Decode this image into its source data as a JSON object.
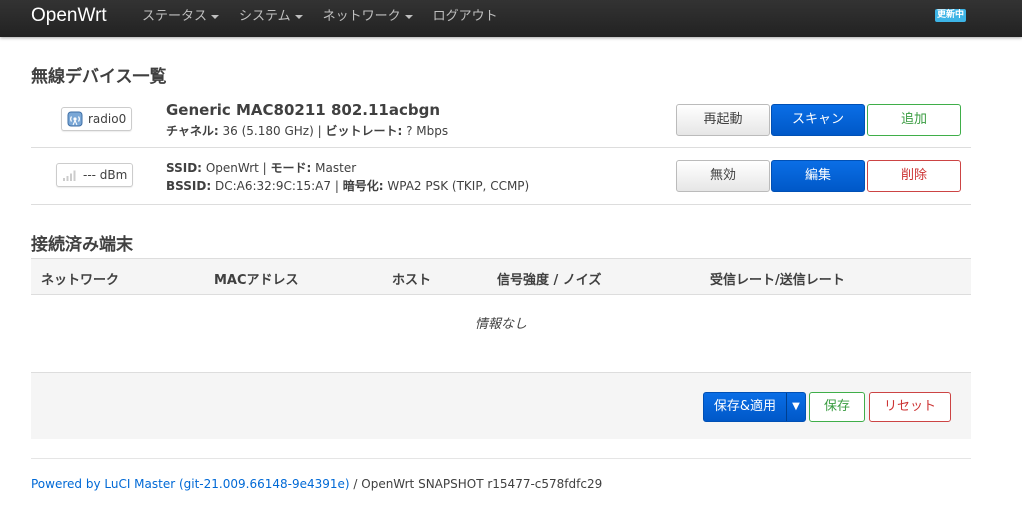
{
  "navbar": {
    "brand": "OpenWrt",
    "menu": [
      {
        "label": "ステータス",
        "dropdown": true
      },
      {
        "label": "システム",
        "dropdown": true
      },
      {
        "label": "ネットワーク",
        "dropdown": true
      },
      {
        "label": "ログアウト",
        "dropdown": false
      }
    ],
    "badge": "更新中"
  },
  "wireless": {
    "heading": "無線デバイス一覧",
    "device": {
      "iface_label": "radio0",
      "title": "Generic MAC80211 802.11acbgn",
      "channel_label": "チャネル:",
      "channel_value": "36 (5.180 GHz)",
      "sep": "|",
      "bitrate_label": "ビットレート:",
      "bitrate_value": "? Mbps",
      "buttons": {
        "restart": "再起動",
        "scan": "スキャン",
        "add": "追加"
      }
    },
    "network": {
      "signal_label": "--- dBm",
      "ssid_label": "SSID:",
      "ssid_value": "OpenWrt",
      "mode_label": "モード:",
      "mode_value": "Master",
      "bssid_label": "BSSID:",
      "bssid_value": "DC:A6:32:9C:15:A7",
      "enc_label": "暗号化:",
      "enc_value": "WPA2 PSK (TKIP, CCMP)",
      "buttons": {
        "disable": "無効",
        "edit": "編集",
        "delete": "削除"
      }
    }
  },
  "clients": {
    "heading": "接続済み端末",
    "columns": [
      "ネットワーク",
      "MACアドレス",
      "ホスト",
      "信号強度 / ノイズ",
      "受信レート/送信レート"
    ],
    "empty_text": "情報なし"
  },
  "actions": {
    "save_apply": "保存&適用",
    "save": "保存",
    "reset": "リセット"
  },
  "footer": {
    "link_text": "Powered by LuCI Master (git-21.009.66148-9e4391e)",
    "rest": " / OpenWrt SNAPSHOT r15477-c578fdfc29"
  },
  "colors": {
    "navbar": "#222222",
    "primary": "#0058c8",
    "positive": "#3a9c41",
    "negative": "#cc3333",
    "badge": "#3db4e6",
    "link": "#0069d6"
  }
}
